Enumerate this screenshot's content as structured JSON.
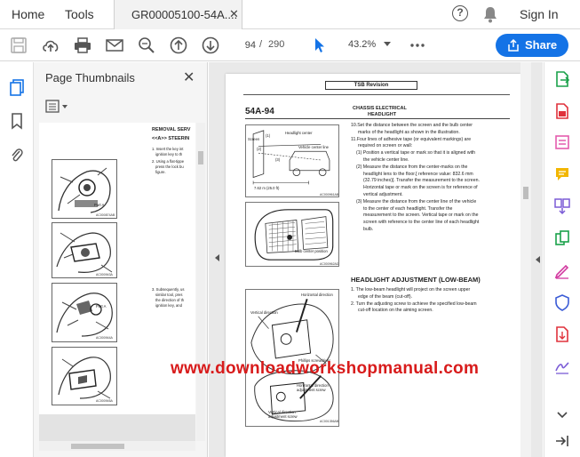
{
  "tabs": {
    "home": "Home",
    "tools": "Tools",
    "document": "GR00005100-54A....",
    "close_glyph": "✕"
  },
  "header": {
    "sign_in": "Sign In",
    "help_glyph": "?"
  },
  "toolbar": {
    "current_page": "94",
    "separator": "/",
    "total_pages": "290",
    "zoom": "43.2%",
    "share_label": "Share"
  },
  "thumbnail_panel": {
    "title": "Page Thumbnails",
    "close_glyph": "✕",
    "thumbs": {
      "removal_heading": "REMOVAL SERV",
      "steering_heading": "<<A>> STEERIN",
      "step1_lines": [
        "1. Insert the key int",
        "ignition key to th"
      ],
      "step2_lines": [
        "2. Using a flat-tippe",
        "press the lock bu",
        "figure."
      ],
      "step3_lines": [
        "3. Subsequently, us",
        "similar tool, pres",
        "the direction of th",
        "ignition key, and"
      ],
      "part_a_1": "Part A",
      "part_a_2": "Part A",
      "codes": [
        "AC000874AB",
        "AC000943A",
        "AC000944A",
        "AC000945A"
      ]
    }
  },
  "document_page": {
    "tsb_label": "TSB Revision",
    "page_number": "54A-94",
    "section_line1": "CHASSIS ELECTRICAL",
    "section_line2": "HEADLIGHT",
    "paragraphs": [
      "10.Set the distance between the screen and the bulb center",
      "marks of the headlight as shown in the illustration.",
      "11.Four lines of adhesive tape (or equivalent markings) are",
      "required on screen or wall:",
      "(1) Position a vertical tape or mark so that it is aligned with",
      "the vehicle center line.",
      "(2) Measure the distance from the center-marks on the",
      "headlight lens to the floor.[ reference value: 832.6 mm",
      "(32.79 inches)]. Transfer the measurement to the screen.",
      "Horizontal tape or mark on the screen is for reference of",
      "vertical adjustment.",
      "(3) Measure the distance from the center line of the vehicle",
      "to the center of each headlight. Transfer the",
      "measurement to the screen. Vertical tape or mark on the",
      "screen with reference to the center line of each headlight",
      "bulb."
    ],
    "lowbeam_heading": "HEADLIGHT ADJUSTMENT (LOW-BEAM)",
    "lowbeam_steps": [
      "1. The low-beam headlight will project on the screen upper",
      "edge of the beam (cut-off).",
      "2. Turn the adjusting screw to achieve the specified low-beam",
      "cut-off location on the aiming screen."
    ],
    "fig1": {
      "screen": "Screen",
      "headlight_center": "Headlight center",
      "vehicle_center_line": "Vehicle center line",
      "distance": "7.62 m (25.0 ft)",
      "mark1": "(1)",
      "mark2": "(2)",
      "mark3": "(3)",
      "code": "AC000961AB"
    },
    "fig2": {
      "bulb_center": "Bulb center position",
      "code": "AC000962AD"
    },
    "fig3": {
      "horizontal_direction": "Horizontal direction",
      "vertical_direction": "Vertical direction",
      "phillips_screwdriver": "Phillips screwdriver",
      "horizontal_screw": "Horizontal direction adjustment screw",
      "vertical_screw": "Vertical direction adjustment screw",
      "code": "AC001356AB"
    },
    "watermark": "www.downloadworkshopmanual.com"
  },
  "colors": {
    "accent": "#1473e6",
    "watermark": "#d81b1b",
    "selected_tool": "#1473e6"
  },
  "icons": {
    "left_rail": [
      "page-thumbnails-icon",
      "bookmark-icon",
      "attachment-icon"
    ],
    "right_rail": [
      "export-pdf-icon",
      "create-pdf-icon",
      "edit-pdf-icon",
      "comment-icon",
      "combine-files-icon",
      "organize-pages-icon",
      "fill-sign-icon",
      "protect-icon",
      "compress-icon",
      "request-signature-icon",
      "more-tools-chevron-icon",
      "collapse-pane-icon"
    ]
  }
}
